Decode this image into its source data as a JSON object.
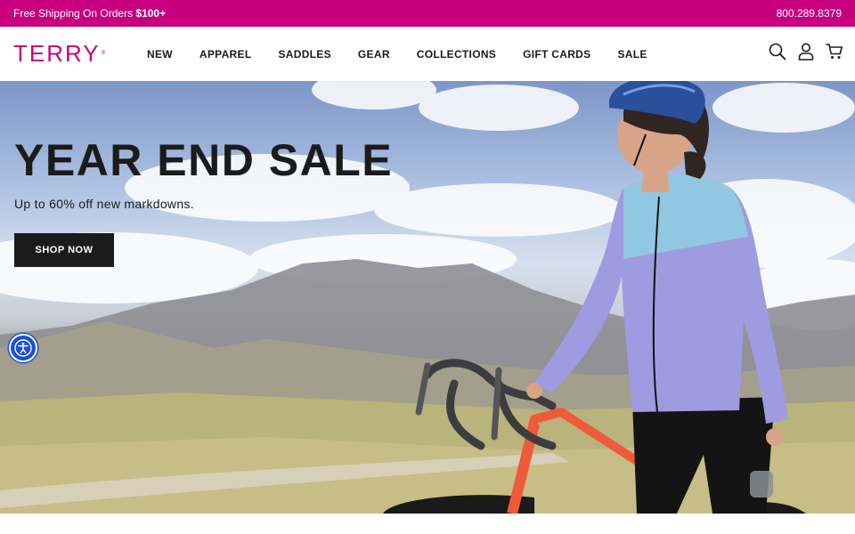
{
  "promo": {
    "shipping_prefix": "Free Shipping On Orders ",
    "shipping_amount": "$100+",
    "phone": "800.289.8379"
  },
  "header": {
    "logo_text": "TERRY",
    "nav": [
      {
        "label": "NEW"
      },
      {
        "label": "APPAREL"
      },
      {
        "label": "SADDLES"
      },
      {
        "label": "GEAR"
      },
      {
        "label": "COLLECTIONS"
      },
      {
        "label": "GIFT CARDS"
      },
      {
        "label": "SALE"
      }
    ],
    "icons": [
      "search-icon",
      "account-icon",
      "cart-icon"
    ]
  },
  "hero": {
    "title": "YEAR END SALE",
    "subtitle": "Up to 60% off new markdowns.",
    "cta_label": "SHOP NOW"
  },
  "colors": {
    "brand": "#c8007f",
    "text": "#1b1b1b",
    "accessibility_blue": "#1a4fd6"
  },
  "accessibility": {
    "icon": "accessibility-icon"
  }
}
